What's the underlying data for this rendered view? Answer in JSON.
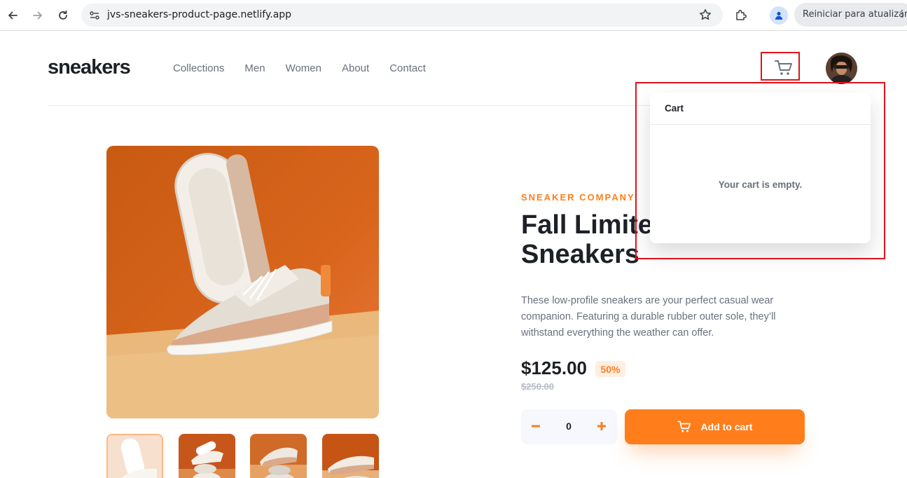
{
  "browser": {
    "url": "jvs-sneakers-product-page.netlify.app",
    "restart_label": "Reiniciar para atualizar"
  },
  "site": {
    "logo": "sneakers",
    "nav": [
      "Collections",
      "Men",
      "Women",
      "About",
      "Contact"
    ]
  },
  "cart": {
    "title": "Cart",
    "empty_message": "Your cart is empty."
  },
  "product": {
    "company": "SNEAKER COMPANY",
    "title": "Fall Limited Edition Sneakers",
    "description": "These low-profile sneakers are your perfect casual wear companion. Featuring a durable rubber outer sole, they’ll withstand everything the weather can offer.",
    "price": "$125.00",
    "discount": "50%",
    "original_price": "$250.00",
    "quantity": "0",
    "add_label": "Add to cart"
  },
  "gallery": {
    "thumbnail_count": 4,
    "active_index": 0
  },
  "colors": {
    "accent": "#ff7e1b",
    "accent_pale": "#ffeee2",
    "text_dark": "#1d2026",
    "text_muted": "#69707d",
    "annotation": "#e0131b"
  }
}
